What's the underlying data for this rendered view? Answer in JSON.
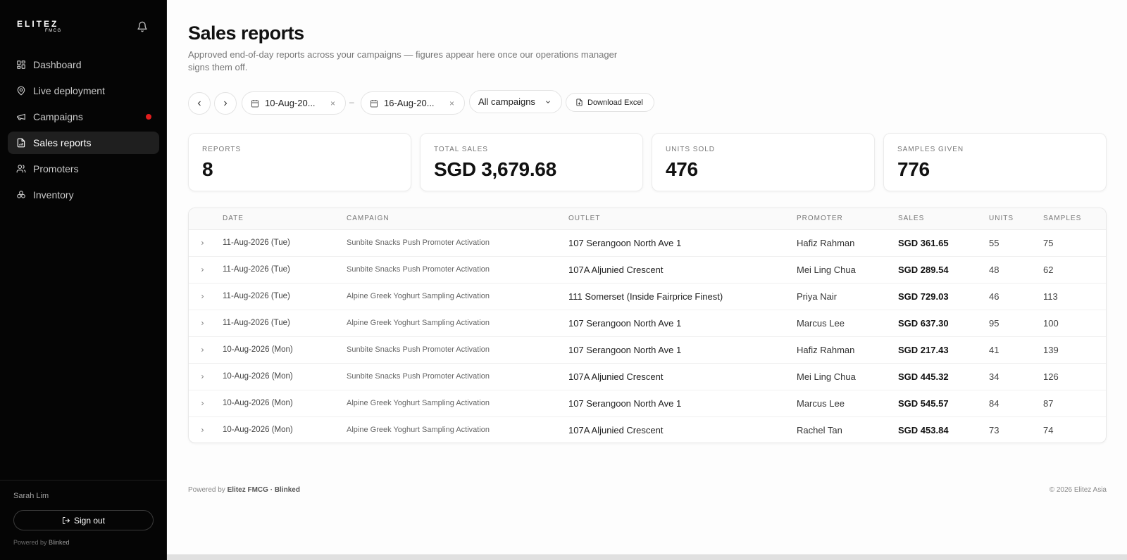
{
  "sidebar": {
    "logo": "ELITEZ",
    "logo_sub": "FMCG",
    "items": [
      {
        "label": "Dashboard",
        "icon": "grid-icon"
      },
      {
        "label": "Live deployment",
        "icon": "map-pin-icon"
      },
      {
        "label": "Campaigns",
        "icon": "megaphone-icon",
        "badge": true
      },
      {
        "label": "Sales reports",
        "icon": "file-chart-icon",
        "active": true
      },
      {
        "label": "Promoters",
        "icon": "users-icon"
      },
      {
        "label": "Inventory",
        "icon": "boxes-icon"
      }
    ],
    "user_name": "Sarah Lim",
    "sign_out": "Sign out",
    "powered_prefix": "Powered by",
    "powered_brand": "Blinked"
  },
  "header": {
    "title": "Sales reports",
    "subtitle": "Approved end-of-day reports across your campaigns — figures appear here once our operations manager signs them off."
  },
  "filters": {
    "date_from": "10-Aug-20...",
    "date_to": "16-Aug-20...",
    "dash": "–",
    "campaign_select": "All campaigns",
    "download_label": "Download Excel",
    "clear_symbol": "×"
  },
  "stats": [
    {
      "label": "REPORTS",
      "value": "8"
    },
    {
      "label": "TOTAL SALES",
      "value": "SGD 3,679.68"
    },
    {
      "label": "UNITS SOLD",
      "value": "476"
    },
    {
      "label": "SAMPLES GIVEN",
      "value": "776"
    }
  ],
  "table": {
    "columns": [
      "",
      "DATE",
      "CAMPAIGN",
      "OUTLET",
      "PROMOTER",
      "SALES",
      "UNITS",
      "SAMPLES"
    ],
    "rows": [
      {
        "date": "11-Aug-2026 (Tue)",
        "campaign": "Sunbite Snacks Push Promoter Activation",
        "outlet": "107 Serangoon North Ave 1",
        "promoter": "Hafiz Rahman",
        "sales": "SGD 361.65",
        "units": "55",
        "samples": "75"
      },
      {
        "date": "11-Aug-2026 (Tue)",
        "campaign": "Sunbite Snacks Push Promoter Activation",
        "outlet": "107A Aljunied Crescent",
        "promoter": "Mei Ling Chua",
        "sales": "SGD 289.54",
        "units": "48",
        "samples": "62"
      },
      {
        "date": "11-Aug-2026 (Tue)",
        "campaign": "Alpine Greek Yoghurt Sampling Activation",
        "outlet": "111 Somerset (Inside Fairprice Finest)",
        "promoter": "Priya Nair",
        "sales": "SGD 729.03",
        "units": "46",
        "samples": "113"
      },
      {
        "date": "11-Aug-2026 (Tue)",
        "campaign": "Alpine Greek Yoghurt Sampling Activation",
        "outlet": "107 Serangoon North Ave 1",
        "promoter": "Marcus Lee",
        "sales": "SGD 637.30",
        "units": "95",
        "samples": "100"
      },
      {
        "date": "10-Aug-2026 (Mon)",
        "campaign": "Sunbite Snacks Push Promoter Activation",
        "outlet": "107 Serangoon North Ave 1",
        "promoter": "Hafiz Rahman",
        "sales": "SGD 217.43",
        "units": "41",
        "samples": "139"
      },
      {
        "date": "10-Aug-2026 (Mon)",
        "campaign": "Sunbite Snacks Push Promoter Activation",
        "outlet": "107A Aljunied Crescent",
        "promoter": "Mei Ling Chua",
        "sales": "SGD 445.32",
        "units": "34",
        "samples": "126"
      },
      {
        "date": "10-Aug-2026 (Mon)",
        "campaign": "Alpine Greek Yoghurt Sampling Activation",
        "outlet": "107 Serangoon North Ave 1",
        "promoter": "Marcus Lee",
        "sales": "SGD 545.57",
        "units": "84",
        "samples": "87"
      },
      {
        "date": "10-Aug-2026 (Mon)",
        "campaign": "Alpine Greek Yoghurt Sampling Activation",
        "outlet": "107A Aljunied Crescent",
        "promoter": "Rachel Tan",
        "sales": "SGD 453.84",
        "units": "73",
        "samples": "74"
      }
    ]
  },
  "footer": {
    "powered_prefix": "Powered by",
    "powered_brand": "Elitez FMCG · Blinked",
    "copyright": "© 2026 Elitez Asia"
  },
  "colors": {
    "sidebar_bg": "#050505",
    "active_item_bg": "#1f1f1f",
    "badge_red": "#e11d1d"
  }
}
